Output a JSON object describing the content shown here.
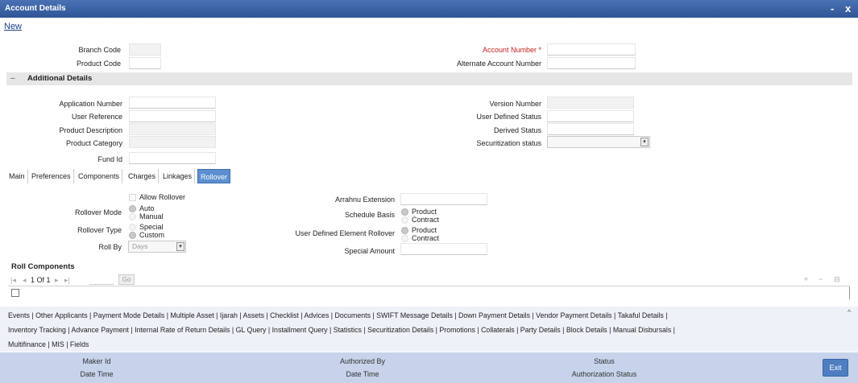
{
  "window": {
    "title": "Account Details",
    "minimize": "-",
    "close": "x"
  },
  "toolbar": {
    "new_label": "New"
  },
  "header": {
    "branch_code": {
      "label": "Branch Code",
      "value": ""
    },
    "product_code": {
      "label": "Product Code",
      "value": ""
    },
    "account_number": {
      "label": "Account Number *",
      "value": ""
    },
    "alternate_account_number": {
      "label": "Alternate Account Number",
      "value": ""
    }
  },
  "additional": {
    "section_label": "Additional Details",
    "collapse_symbol": "–",
    "application_number": {
      "label": "Application Number",
      "value": ""
    },
    "user_reference": {
      "label": "User Reference",
      "value": ""
    },
    "product_description": {
      "label": "Product Description",
      "value": ""
    },
    "product_category": {
      "label": "Product Category",
      "value": ""
    },
    "fund_id": {
      "label": "Fund Id",
      "value": ""
    },
    "version_number": {
      "label": "Version Number",
      "value": ""
    },
    "user_defined_status": {
      "label": "User Defined Status",
      "value": ""
    },
    "derived_status": {
      "label": "Derived Status",
      "value": ""
    },
    "securitization_status": {
      "label": "Securitization status",
      "value": ""
    }
  },
  "tabs": [
    {
      "label": "Main"
    },
    {
      "label": "Preferences"
    },
    {
      "label": "Components"
    },
    {
      "label": "Charges"
    },
    {
      "label": "Linkages"
    },
    {
      "label": "Rollover",
      "active": true
    }
  ],
  "rollover": {
    "allow_rollover": "Allow Rollover",
    "rollover_mode_label": "Rollover Mode",
    "mode_auto": "Auto",
    "mode_manual": "Manual",
    "rollover_type_label": "Rollover Type",
    "type_special": "Special",
    "type_custom": "Custom",
    "roll_by_label": "Roll By",
    "roll_by_value": "Days",
    "arrahnu_extension_label": "Arrahnu Extension",
    "schedule_basis_label": "Schedule Basis",
    "sb_product": "Product",
    "sb_contract": "Contract",
    "udf_rollover_label": "User Defined Element Rollover",
    "ud_product": "Product",
    "ud_contract": "Contract",
    "special_amount_label": "Special Amount"
  },
  "roll_components": {
    "title": "Roll Components",
    "page_info": "1 Of 1",
    "go_label": "Go",
    "nav_first": "|◂",
    "nav_prev": "◂",
    "nav_next": "▸",
    "nav_last": "▸|",
    "add": "+",
    "remove": "−",
    "view": "⊟"
  },
  "subsystems": {
    "line1": "Events  |  Other Applicants  |  Payment Mode Details  |  Multiple Asset  |  Ijarah  |  Assets  |  Checklist  |  Advices  |  Documents  |  SWIFT Message Details  |  Down Payment Details  |  Vendor Payment Details  |  Takaful Details  |",
    "line2": "Inventory Tracking  |  Advance Payment  |  Internal Rate of Return Details  |  GL Query  |  Installment Query  |  Statistics  |  Securitization Details  |  Promotions  |  Collaterals  |  Party Details  |  Block Details  |  Manual Disbursals  |",
    "line3": "Multifinance  |  MIS  |  Fields",
    "caret": "^"
  },
  "footer": {
    "maker_id": "Maker Id",
    "date_time_1": "Date Time",
    "authorized_by": "Authorized By",
    "date_time_2": "Date Time",
    "status": "Status",
    "authorization_status": "Authorization Status",
    "exit_label": "Exit"
  },
  "colors": {
    "titlebar": "#2f5596",
    "active_tab": "#5b8fd0",
    "footer": "#c6d3ea",
    "required": "#c81e1e"
  }
}
